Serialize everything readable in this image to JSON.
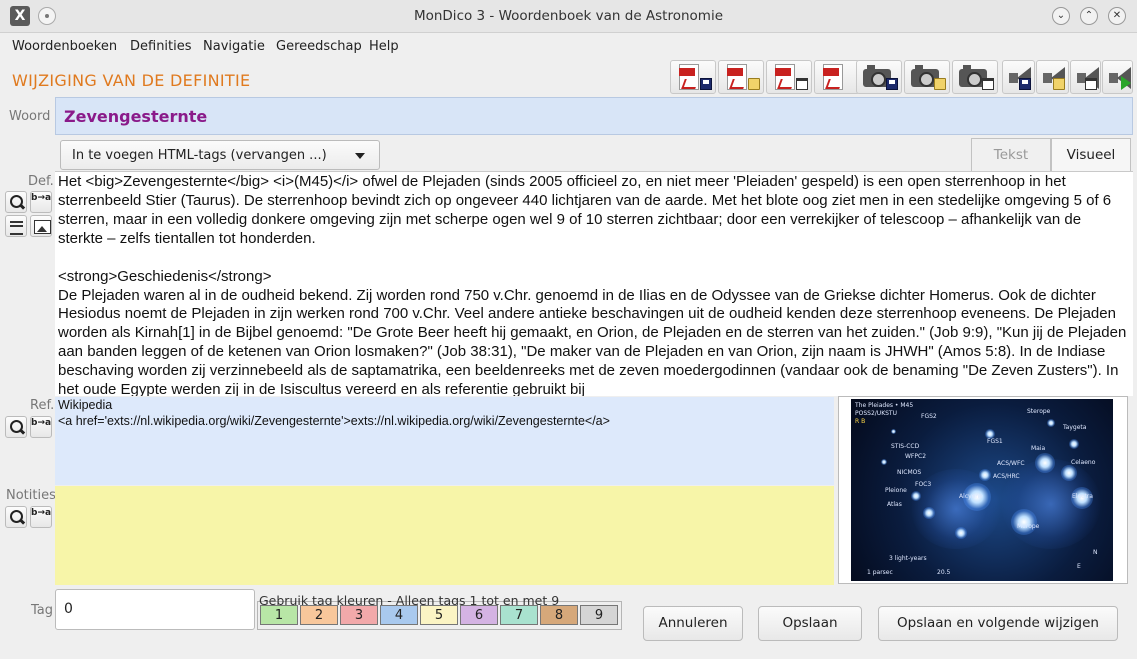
{
  "window": {
    "title": "MonDico 3 - Woordenboek van de Astronomie",
    "app_icon": "X"
  },
  "menu": [
    "Woordenboeken",
    "Definities",
    "Navigatie",
    "Gereedschap",
    "Help"
  ],
  "heading": "WIJZIGING VAN DE DEFINITIE",
  "toolbar_icons": [
    "pdf-save-icon",
    "pdf-open-icon",
    "pdf-delete-icon",
    "pdf-icon",
    "camera-save-icon",
    "camera-open-icon",
    "camera-delete-icon",
    "speaker-save-icon",
    "speaker-open-icon",
    "speaker-delete-icon",
    "speaker-play-icon"
  ],
  "labels": {
    "woord": "Woord",
    "def": "Def.",
    "ref": "Ref.",
    "notities": "Notities",
    "tag": "Tag"
  },
  "word_value": "Zevengesternte",
  "html_tag_combo": "In te voegen HTML-tags (vervangen ...)",
  "tabs": {
    "text": "Tekst",
    "visual": "Visueel"
  },
  "icon_glyphs": {
    "replace": "b→a"
  },
  "definition": {
    "p1": "Het <big>Zevengesternte</big> <i>(M45)</i> ofwel de Plejaden (sinds 2005 officieel zo, en niet meer 'Pleiaden' gespeld) is een open sterrenhoop in het sterrenbeeld Stier (Taurus). De sterrenhoop bevindt zich op ongeveer 440 lichtjaren van de aarde. Met het blote oog ziet men in een stedelijke omgeving 5 of 6 sterren, maar in een volledig donkere omgeving zijn met scherpe ogen wel 9 of 10 sterren zichtbaar; door een verrekijker of telescoop – afhankelijk van de sterkte – zelfs tientallen tot honderden.",
    "p2": "<strong>Geschiedenis</strong>",
    "p3": "De Plejaden waren al in de oudheid bekend. Zij worden rond 750 v.Chr. genoemd in de Ilias en de Odyssee van de Griekse dichter Homerus. Ook de dichter Hesiodus noemt de Plejaden in zijn werken rond 700 v.Chr. Veel andere antieke beschavingen uit de oudheid kenden deze sterrenhoop eveneens. De Plejaden worden als Kirnah[1] in de Bijbel genoemd: \"De Grote Beer heeft hij gemaakt, en Orion, de Plejaden en de sterren van het zuiden.\" (Job 9:9), \"Kun jij de Plejaden aan banden leggen of de ketenen van Orion losmaken?\" (Job 38:31), \"De maker van de Plejaden en van Orion, zijn naam is JHWH\" (Amos 5:8). In de Indiase beschaving worden zij verzinnebeeld als de saptamatrika, een beeldenreeks met de zeven moedergodinnen (vandaar ook de benaming \"De Zeven Zusters\"). In het oude Egypte werden zij in de Isiscultus vereerd en als referentie gebruikt bij"
  },
  "reference": {
    "line1": "Wikipedia",
    "line2": "<a href='exts://nl.wikipedia.org/wiki/Zevengesternte'>exts://nl.wikipedia.org/wiki/Zevengesternte</a>"
  },
  "notes": "",
  "image": {
    "caption1": "The Pleiades • M45",
    "caption2": "POSS2/UKSTU",
    "caption3": "R B",
    "labels": [
      "FGS2",
      "FGS1",
      "STIS-CCD",
      "WFPC2",
      "ACS/WFC",
      "ACS/HRC",
      "NICMOS",
      "FOC3",
      "Sterope",
      "Taygeta",
      "Maia",
      "Celaeno",
      "Electra",
      "Pleione",
      "Atlas",
      "Alcyone",
      "Merope"
    ],
    "scale1": "3 light-years",
    "scale2": "1 parsec",
    "scale3": "20.5",
    "north": "N",
    "east": "E"
  },
  "tag_value": "0",
  "tag_legend": "Gebruik tag kleuren - Alleen tags 1 tot en met 9",
  "tag_colors": [
    {
      "n": "1",
      "color": "#b8e6a6"
    },
    {
      "n": "2",
      "color": "#f8c79b"
    },
    {
      "n": "3",
      "color": "#f2a9aa"
    },
    {
      "n": "4",
      "color": "#a9c9ee"
    },
    {
      "n": "5",
      "color": "#fbf4c4"
    },
    {
      "n": "6",
      "color": "#d4b3e3"
    },
    {
      "n": "7",
      "color": "#a9e2cf"
    },
    {
      "n": "8",
      "color": "#d6a87a"
    },
    {
      "n": "9",
      "color": "#d5d5d5"
    }
  ],
  "buttons": {
    "cancel": "Annuleren",
    "save": "Opslaan",
    "save_next": "Opslaan en volgende wijzigen"
  }
}
